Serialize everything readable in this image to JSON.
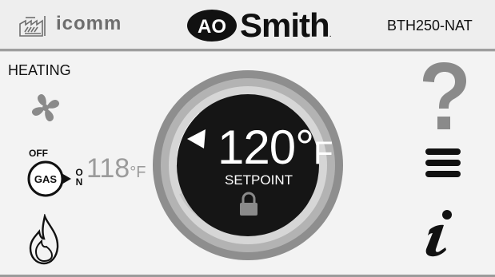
{
  "header": {
    "app_name": "icomm",
    "brand_left": "AO",
    "brand_right": "Smith",
    "brand_mark": ".",
    "model": "BTH250-NAT"
  },
  "status": {
    "mode": "HEATING",
    "gas_label": "GAS",
    "off_label": "OFF",
    "on_label_o": "O",
    "on_label_n": "N"
  },
  "temperatures": {
    "current_value": "118",
    "current_unit": "°F",
    "setpoint_value": "120°",
    "setpoint_unit": "F",
    "setpoint_label": "SETPOINT"
  },
  "icons": {
    "left": [
      "building-icon",
      "fan-icon",
      "gas-valve-icon",
      "flame-icon"
    ],
    "right": [
      "help-icon",
      "menu-icon",
      "info-icon"
    ],
    "dial": [
      "setpoint-marker-icon",
      "lock-icon"
    ]
  },
  "colors": {
    "background": "#f3f3f3",
    "dial_center": "#151515",
    "ring_dark": "#8e8e8e",
    "ring_light": "#d6d6d6",
    "icon_gray": "#8a8a8a",
    "current_temp": "#9b9b9b"
  }
}
